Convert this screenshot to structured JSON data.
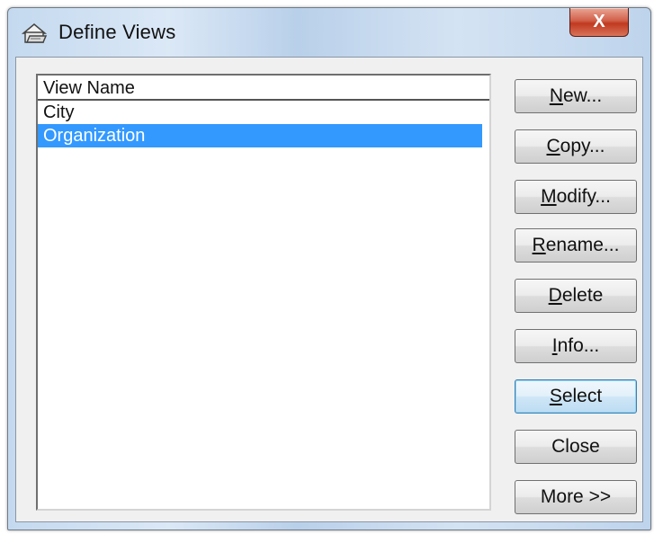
{
  "window": {
    "title": "Define Views",
    "close_glyph": "X"
  },
  "list": {
    "header": "View Name",
    "items": [
      {
        "label": "City",
        "selected": false
      },
      {
        "label": "Organization",
        "selected": true
      }
    ]
  },
  "buttons": [
    {
      "mnemonic": "N",
      "rest": "ew...",
      "label": "New..."
    },
    {
      "mnemonic": "C",
      "rest": "opy...",
      "label": "Copy..."
    },
    {
      "mnemonic": "M",
      "rest": "odify...",
      "label": "Modify..."
    },
    {
      "mnemonic": "R",
      "rest": "ename...",
      "label": "Rename..."
    },
    {
      "mnemonic": "D",
      "rest": "elete",
      "label": "Delete"
    },
    {
      "mnemonic": "I",
      "rest": "nfo...",
      "label": "Info..."
    },
    {
      "mnemonic": "S",
      "rest": "elect",
      "label": "Select",
      "default": true
    },
    {
      "mnemonic": "",
      "rest": "Close",
      "label": "Close"
    },
    {
      "mnemonic": "",
      "rest": "More >>",
      "label": "More >>"
    }
  ],
  "colors": {
    "selection": "#3399ff",
    "close_button": "#c8452b",
    "dialog_face": "#f0f0f0"
  },
  "icons": {
    "app": "views-folder-icon",
    "close": "close-icon"
  }
}
